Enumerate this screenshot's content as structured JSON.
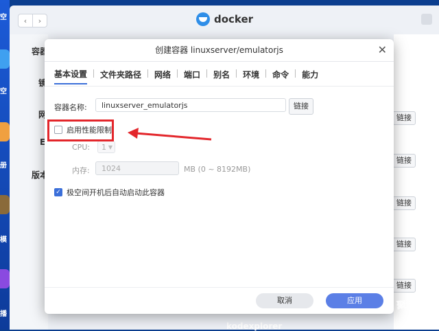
{
  "app": {
    "title": "docker"
  },
  "desktop": {
    "labels": [
      "空",
      "空",
      "册",
      "模",
      "播"
    ]
  },
  "background": {
    "sidebar": [
      "容器",
      "镜",
      "网",
      "E",
      "版本"
    ],
    "link_label": "链接",
    "footer_text": "kodexplorer"
  },
  "modal": {
    "title": "创建容器 linuxserver/emulatorjs",
    "tabs": [
      "基本设置",
      "文件夹路径",
      "网络",
      "端口",
      "别名",
      "环境",
      "命令",
      "能力"
    ],
    "container_name": {
      "label": "容器名称:",
      "value": "linuxserver_emulatorjs",
      "link_button": "链接"
    },
    "perf_limit": {
      "label": "启用性能限制",
      "checked": false
    },
    "cpu": {
      "label": "CPU:",
      "value": "1"
    },
    "memory": {
      "label": "内存:",
      "value": "1024",
      "unit_range": "MB (0 ~ 8192MB)"
    },
    "autostart": {
      "label": "极空间开机后自动启动此容器",
      "checked": true
    },
    "buttons": {
      "cancel": "取消",
      "apply": "应用"
    }
  },
  "watermark": "聚超值",
  "colors": {
    "accent": "#5b7fe6",
    "annotation": "#e3262b"
  }
}
